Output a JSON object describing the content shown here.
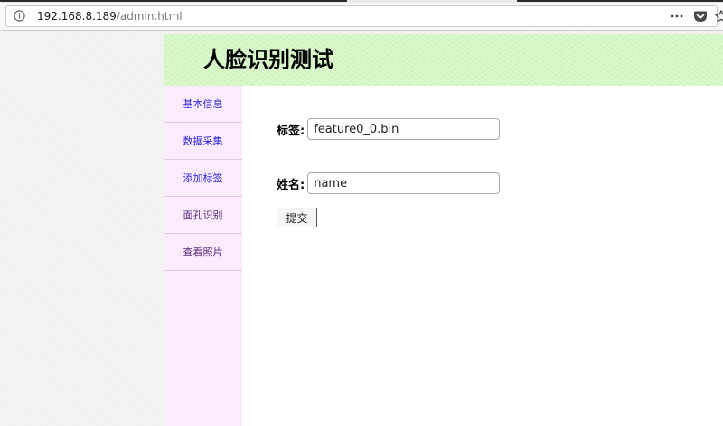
{
  "browser": {
    "url_host": "192.168.8.189",
    "url_path": "/admin.html"
  },
  "header": {
    "title": "人脸识别测试"
  },
  "sidebar": {
    "items": [
      {
        "label": "基本信息"
      },
      {
        "label": "数据采集"
      },
      {
        "label": "添加标签"
      },
      {
        "label": "面孔识别"
      },
      {
        "label": "查看照片"
      }
    ]
  },
  "form": {
    "tag_label": "标签:",
    "tag_value": "feature0_0.bin",
    "name_label": "姓名:",
    "name_value": "name",
    "submit_label": "提交"
  },
  "colors": {
    "header_bg": "#d4f7c4",
    "sidebar_bg": "#fceafd",
    "link": "#2a2ad9"
  },
  "icons": [
    "info-icon",
    "more-icon",
    "pocket-icon",
    "star-icon"
  ]
}
